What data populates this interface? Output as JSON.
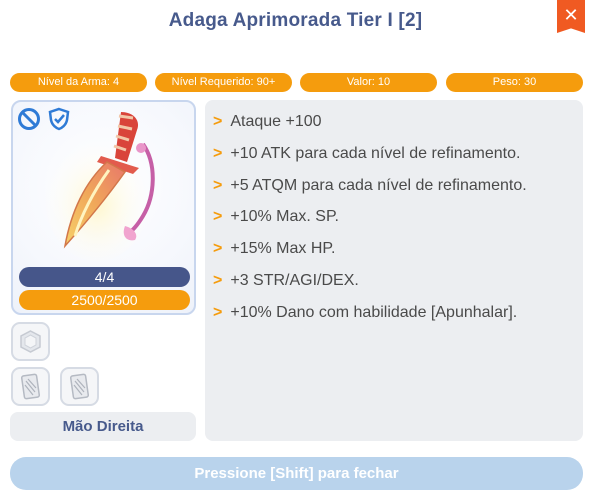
{
  "window": {
    "title": "Adaga Aprimorada Tier I [2]",
    "close_symbol": "✕",
    "accent_color": "#f59c0d",
    "title_color": "#475a8c",
    "close_color": "#f05a22"
  },
  "stats": [
    {
      "label": "Nível da Arma: 4"
    },
    {
      "label": "Nível Requerido: 90+"
    },
    {
      "label": "Valor: 10"
    },
    {
      "label": "Peso: 30"
    }
  ],
  "item": {
    "icons": [
      "no-trade-icon",
      "shield-icon"
    ],
    "image": "dagger-icon",
    "count": "4/4",
    "durability": "2500/2500",
    "durability_fraction": 1.0,
    "slots": [
      "empty-card-slot-icon",
      "card-slot-icon",
      "card-slot-icon"
    ],
    "equip_position": "Mão Direita"
  },
  "description": {
    "bullet": ">",
    "lines": [
      "Ataque +100",
      "+10 ATK para cada nível de refinamento.",
      "+5 ATQM para cada nível de refinamento.",
      "+10% Max. SP.",
      "+15% Max HP.",
      "+3 STR/AGI/DEX.",
      "+10% Dano com habilidade [Apunhalar]."
    ]
  },
  "footer": {
    "hint": "Pressione [Shift] para fechar"
  }
}
